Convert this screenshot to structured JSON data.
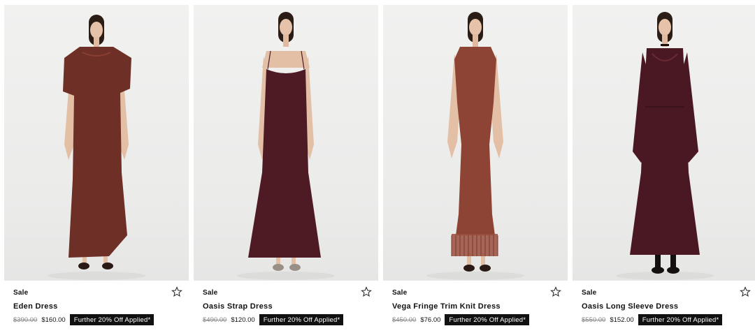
{
  "products": [
    {
      "tag": "Sale",
      "name": "Eden Dress",
      "original_price": "$390.00",
      "sale_price": "$160.00",
      "promo": "Further 20% Off Applied*",
      "dress_color": "#6e2f26",
      "icon": "star-outline-icon"
    },
    {
      "tag": "Sale",
      "name": "Oasis Strap Dress",
      "original_price": "$490.00",
      "sale_price": "$120.00",
      "promo": "Further 20% Off Applied*",
      "dress_color": "#4e1a24",
      "icon": "star-outline-icon"
    },
    {
      "tag": "Sale",
      "name": "Vega Fringe Trim Knit Dress",
      "original_price": "$450.00",
      "sale_price": "$76.00",
      "promo": "Further 20% Off Applied*",
      "dress_color": "#8e4434",
      "icon": "star-outline-icon"
    },
    {
      "tag": "Sale",
      "name": "Oasis Long Sleeve Dress",
      "original_price": "$550.00",
      "sale_price": "$152.00",
      "promo": "Further 20% Off Applied*",
      "dress_color": "#4a1822",
      "icon": "star-outline-icon"
    }
  ]
}
